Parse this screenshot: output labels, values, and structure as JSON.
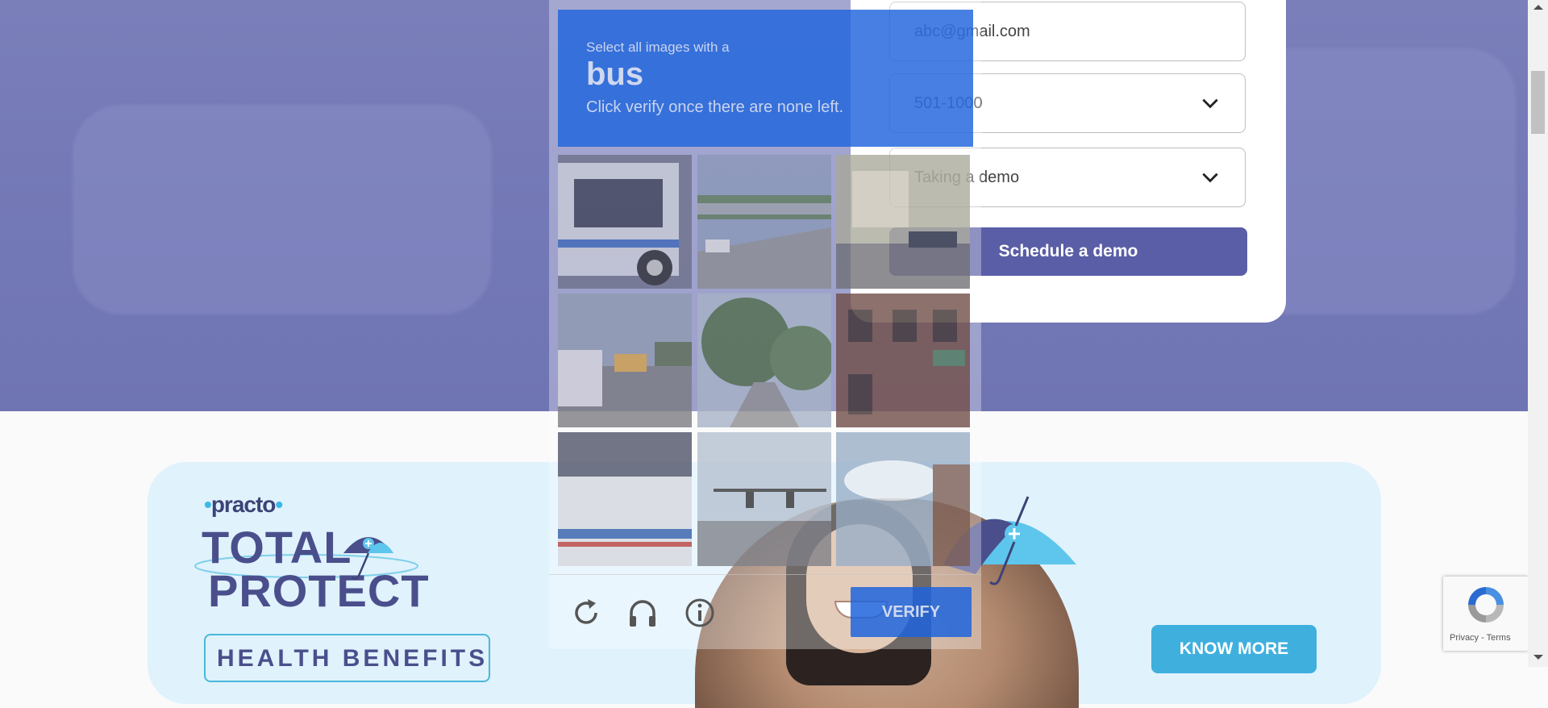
{
  "form": {
    "email_value": "abc@gmail.com",
    "company_size_value": "501-1000",
    "purpose_value": "Taking a demo",
    "submit_label": "Schedule a demo"
  },
  "captcha": {
    "prompt_line1": "Select all images with a",
    "prompt_target": "bus",
    "prompt_line3": "Click verify once there are none left.",
    "verify_label": "VERIFY",
    "tiles": [
      "bus-side",
      "highway-bridge",
      "street-storefront",
      "street-school-bus",
      "tree-lined-road",
      "brick-building",
      "bus-window",
      "traffic-light-street",
      "cloudy-building"
    ]
  },
  "banner": {
    "brand": "practo",
    "title_line1": "TOTAL",
    "title_line2": "PROTECT",
    "subtitle": "HEALTH BENEFITS",
    "cta_label": "KNOW MORE",
    "accent_color": "#3fb0de",
    "title_color": "#4a4f8c"
  },
  "recaptcha": {
    "links": "Privacy - Terms"
  },
  "colors": {
    "hero": "#7378b6",
    "button_primary": "#5a5ea6",
    "captcha_blue": "#1e64dc"
  }
}
